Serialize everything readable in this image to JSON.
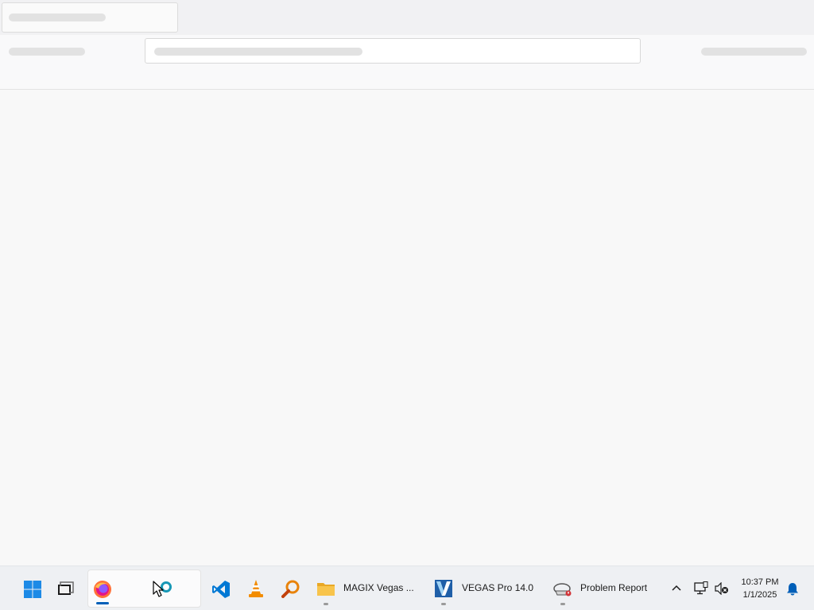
{
  "browser": {
    "tab_loading": true,
    "content_loading": true
  },
  "taskbar": {
    "pinned": [
      {
        "name": "start-button",
        "icon": "windows-logo-icon"
      },
      {
        "name": "task-view-button",
        "icon": "task-view-icon"
      },
      {
        "name": "firefox-button",
        "icon": "firefox-icon",
        "state": "active"
      },
      {
        "name": "search-app-button",
        "icon": "search-ring-icon"
      },
      {
        "name": "vscode-button",
        "icon": "vscode-icon"
      },
      {
        "name": "vlc-button",
        "icon": "vlc-cone-icon"
      },
      {
        "name": "magnifier-app-button",
        "icon": "magnifier-icon"
      }
    ],
    "windows": [
      {
        "label": "MAGIX Vegas ...",
        "icon": "folder-icon"
      },
      {
        "label": "VEGAS Pro 14.0",
        "icon": "vegas-icon"
      },
      {
        "label": "Problem Report",
        "icon": "problem-report-icon"
      }
    ]
  },
  "tray": {
    "time": "10:37 PM",
    "date": "1/1/2025"
  },
  "colors": {
    "accent": "#005fb8",
    "firefox_orange": "#ff7139",
    "vscode_blue": "#0078d4",
    "vlc_orange": "#f28c00",
    "folder_yellow": "#f8c44b"
  }
}
